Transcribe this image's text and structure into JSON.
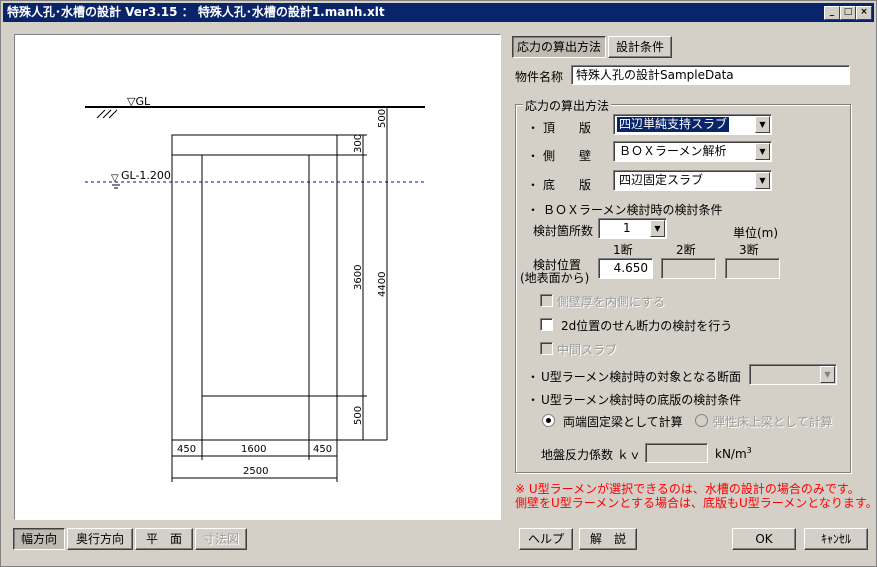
{
  "window": {
    "title": "特殊人孔･水槽の設計 Ver3.15 ： 特殊人孔･水槽の設計1.manh.xlt",
    "min_glyph": "_",
    "max_glyph": "□",
    "close_glyph": "×"
  },
  "tabs": {
    "stress": "応力の算出方法",
    "design": "設計条件"
  },
  "property": {
    "label": "物件名称",
    "value": "特殊人孔の設計SampleData"
  },
  "method_group": {
    "title": "応力の算出方法",
    "bullet": "・",
    "top_label": "頂　　版",
    "top_value": "四辺単純支持スラブ",
    "side_label": "側　　壁",
    "side_value": "ＢＯＸラーメン解析",
    "bottom_label": "底　　版",
    "bottom_value": "四辺固定スラブ",
    "box_title": "ＢＯＸラーメン検討時の検討条件",
    "count_label": "検討箇所数",
    "count_value": "1",
    "unit_label": "単位(m)",
    "section1": "1断",
    "section2": "2断",
    "section3": "3断",
    "position_label1": "検討位置",
    "position_label2": "(地表面から)",
    "position_value1": "4.650",
    "position_value2": "",
    "position_value3": "",
    "chk_inner": "側壁厚を内側にする",
    "chk_2d": "2d位置のせん断力の検討を行う",
    "chk_middle": "中間スラブ",
    "u_target_label": "U型ラーメン検討時の対象となる断面",
    "u_target_value": "",
    "u_bottom_label": "U型ラーメン検討時の底版の検討条件",
    "radio_fixed": "両端固定梁として計算",
    "radio_elastic": "弾性床上梁として計算",
    "kv_label": "地盤反力係数 ｋｖ",
    "kv_value": "",
    "kv_unit": "kN/m",
    "kv_unit_sup": "3"
  },
  "notes": {
    "line1": "※ U型ラーメンが選択できるのは、水槽の設計の場合のみです。",
    "line2": "側壁をU型ラーメンとする場合は、底版もU型ラーメンとなります。"
  },
  "view_buttons": {
    "width": "幅方向",
    "depth": "奥行方向",
    "plan": "平　面",
    "dims": "寸法図"
  },
  "bottom_buttons": {
    "help": "ヘルプ",
    "explain": "解　説",
    "ok": "OK",
    "cancel": "ｷｬﾝｾﾙ"
  },
  "drawing": {
    "gl": "▽GL",
    "water": "GL-1.200",
    "water_mark": "▽",
    "dim_500_top": "500",
    "dim_300": "300",
    "dim_3600": "3600",
    "dim_4400": "4400",
    "dim_500_bot": "500",
    "dim_450_l": "450",
    "dim_1600": "1600",
    "dim_450_r": "450",
    "dim_2500": "2500"
  },
  "colors": {
    "titlebar": "#0a246a",
    "water_line": "#0000cc",
    "note": "#ff0000"
  }
}
